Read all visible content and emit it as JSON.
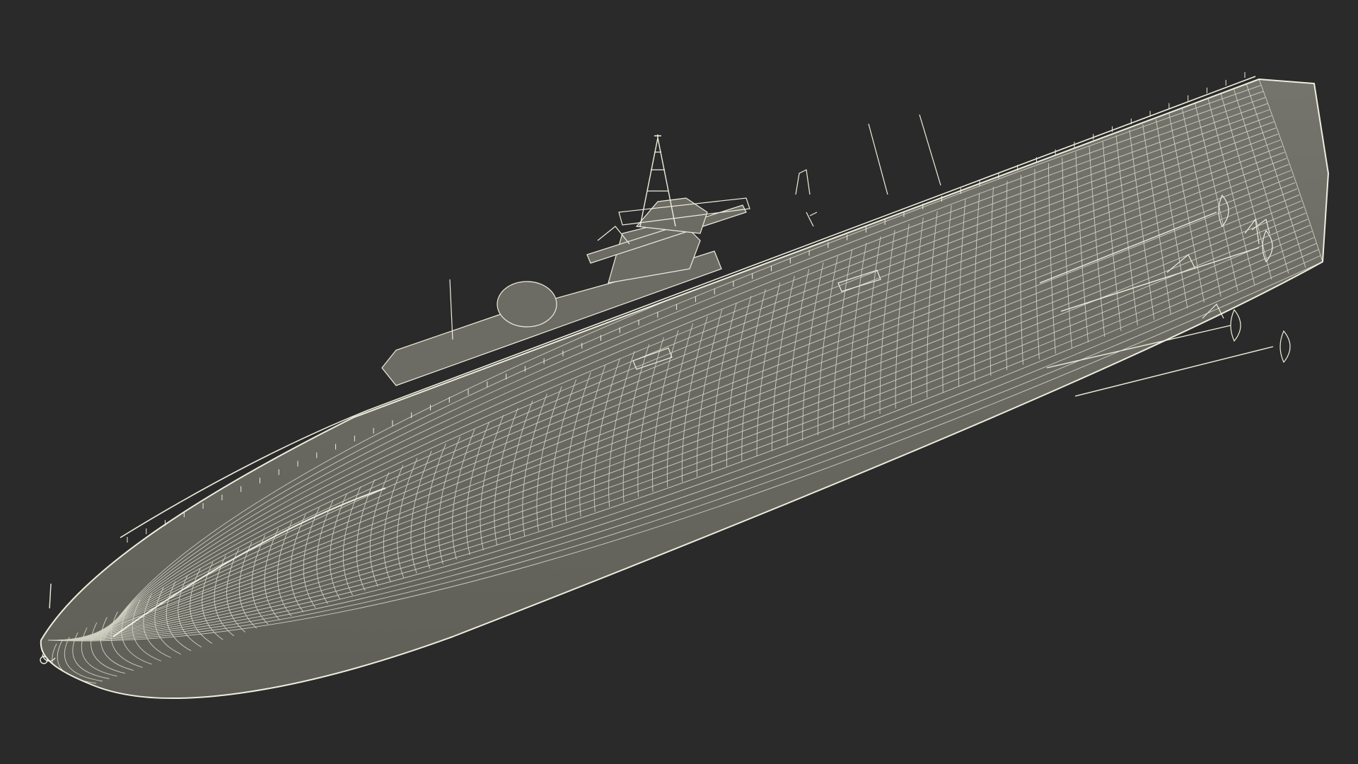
{
  "scene": {
    "background_color": "#2a2a2a",
    "subject": "ship-hull-wireframe",
    "hull_fill_color": "#74746c",
    "hull_shadow_color": "#5f5f58",
    "wire_color": "#eeeede",
    "wire_color_dim": "#cfcfc2"
  }
}
